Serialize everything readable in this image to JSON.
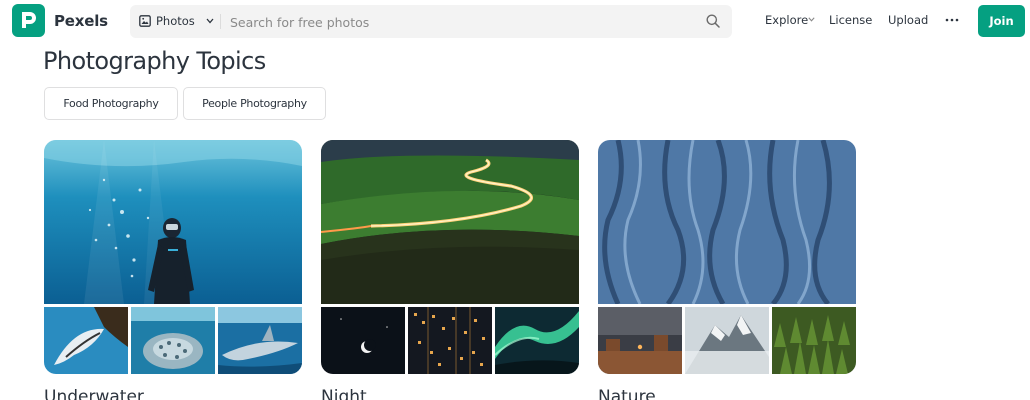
{
  "header": {
    "brand": "Pexels",
    "logo_letter": "P",
    "search": {
      "type_label": "Photos",
      "placeholder": "Search for free photos"
    },
    "nav": {
      "explore": "Explore",
      "license": "License",
      "upload": "Upload",
      "join": "Join"
    },
    "icons": [
      "pexels-logo-icon",
      "image-icon",
      "chevron-down-icon",
      "search-icon",
      "more-icon"
    ]
  },
  "page_title": "Photography Topics",
  "chips": [
    "Food Photography",
    "People Photography"
  ],
  "topics": [
    {
      "label": "Underwater",
      "main_image": "diver-underwater-image",
      "thumbs": [
        "manta-ray-image",
        "coral-image",
        "shark-image"
      ]
    },
    {
      "label": "Night",
      "main_image": "road-light-trails-image",
      "thumbs": [
        "crescent-moon-image",
        "city-night-image",
        "aurora-image"
      ]
    },
    {
      "label": "Nature",
      "main_image": "aerial-ridges-image",
      "thumbs": [
        "desert-buttes-image",
        "snowy-peak-image",
        "pine-forest-image"
      ]
    }
  ],
  "colors": {
    "brand_green": "#05a081",
    "text": "#2c343e",
    "search_bg": "#f3f3f3"
  }
}
